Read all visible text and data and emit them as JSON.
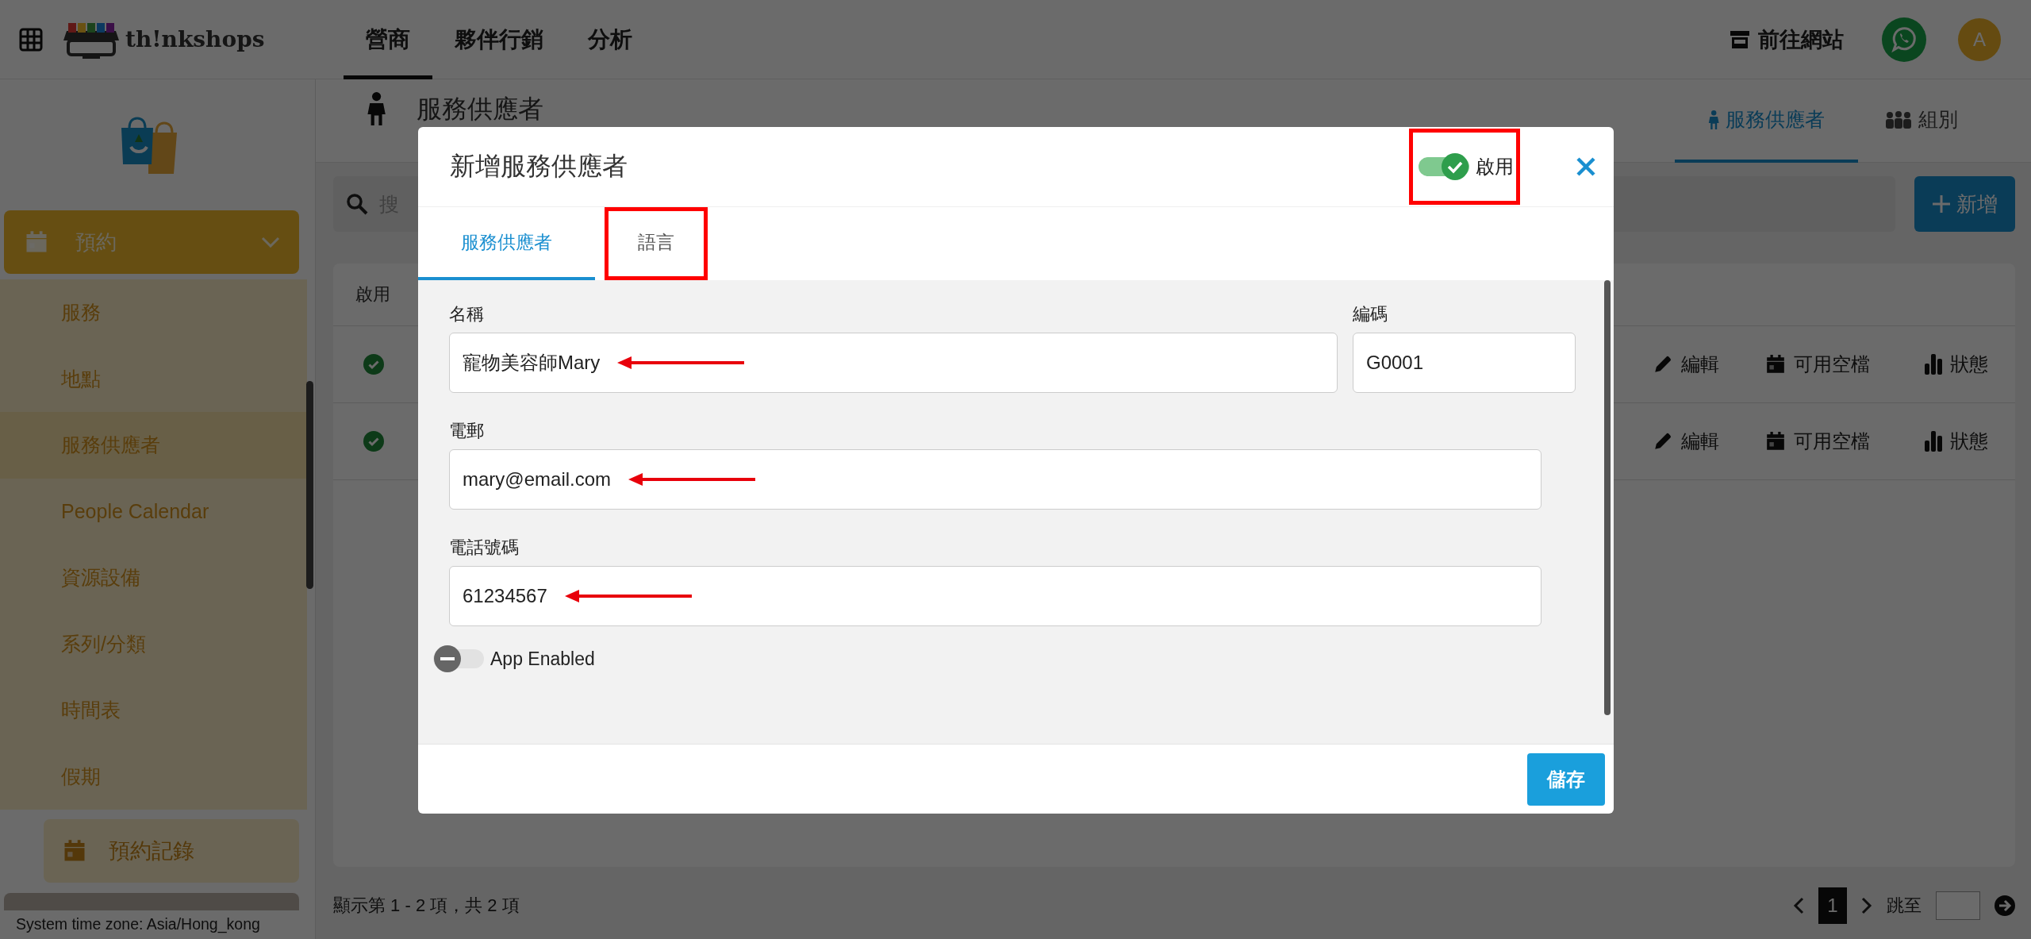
{
  "top_bar": {
    "brand": "th!nkshops",
    "nav": [
      {
        "label": "營商",
        "selected": true
      },
      {
        "label": "夥伴行銷",
        "selected": false
      },
      {
        "label": "分析",
        "selected": false
      }
    ],
    "website_link": "前往網站",
    "avatar": "A"
  },
  "sidebar": {
    "section": {
      "label": "預約",
      "expanded": true
    },
    "items": [
      {
        "label": "服務",
        "selected": false
      },
      {
        "label": "地點",
        "selected": false
      },
      {
        "label": "服務供應者",
        "selected": true
      },
      {
        "label": "People Calendar",
        "selected": false
      },
      {
        "label": "資源設備",
        "selected": false
      },
      {
        "label": "系列/分類",
        "selected": false
      },
      {
        "label": "時間表",
        "selected": false
      },
      {
        "label": "假期",
        "selected": false
      }
    ],
    "bookings_button": "預約記錄",
    "timezone": "System time zone: Asia/Hong_kong"
  },
  "page": {
    "title": "服務供應者",
    "tabs": [
      {
        "label": "服務供應者",
        "selected": true
      },
      {
        "label": "組別",
        "selected": false
      }
    ],
    "search": {
      "placeholder": "搜"
    },
    "add_button": "新增",
    "table": {
      "columns": [
        "啟用"
      ],
      "rows": [
        {
          "enabled": true,
          "actions": [
            "編輯",
            "可用空檔",
            "狀態"
          ]
        },
        {
          "enabled": true,
          "actions": [
            "編輯",
            "可用空檔",
            "狀態"
          ]
        }
      ]
    },
    "footer": {
      "summary": "顯示第 1 - 2 項，共 2 項",
      "pages": [
        {
          "label": "1",
          "selected": true
        }
      ],
      "jump_label": "跳至"
    }
  },
  "dialog": {
    "title": "新增服務供應者",
    "enabled": {
      "label": "啟用",
      "on": true,
      "highlighted": true
    },
    "tabs": [
      {
        "label": "服務供應者",
        "selected": true,
        "highlighted": false
      },
      {
        "label": "語言",
        "selected": false,
        "highlighted": true
      }
    ],
    "fields": [
      {
        "label": "名稱",
        "value": "寵物美容師Mary",
        "marked": true
      },
      {
        "label": "編碼",
        "value": "G0001",
        "marked": false
      },
      {
        "label": "電郵",
        "value": "mary@email.com",
        "marked": true
      },
      {
        "label": "電話號碼",
        "value": "61234567",
        "marked": true
      }
    ],
    "app_enabled": {
      "label": "App Enabled",
      "on": false
    },
    "save_button": "儲存"
  }
}
